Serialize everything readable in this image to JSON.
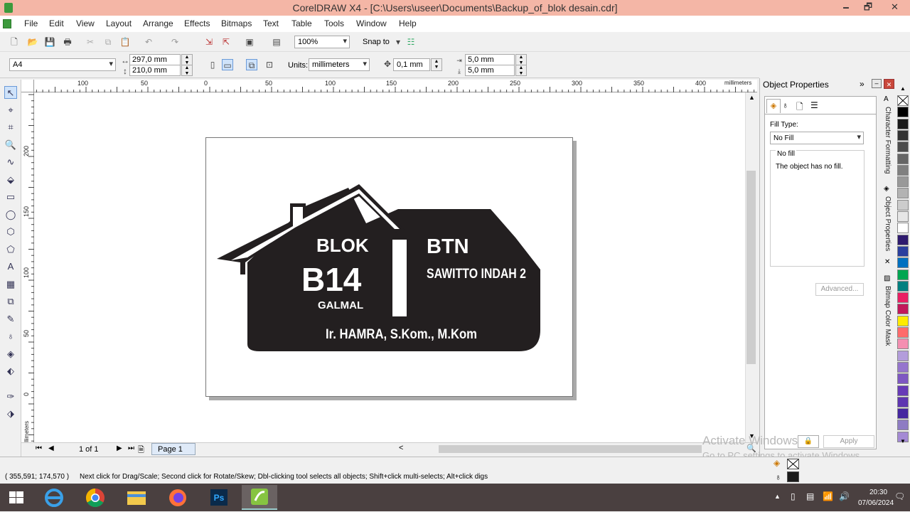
{
  "window": {
    "title": "CorelDRAW X4 - [C:\\Users\\useer\\Documents\\Backup_of_blok desain.cdr]",
    "minimize_glyph": "🗕",
    "restore_glyph": "🗗",
    "close_glyph": "✕"
  },
  "menu": [
    "File",
    "Edit",
    "View",
    "Layout",
    "Arrange",
    "Effects",
    "Bitmaps",
    "Text",
    "Table",
    "Tools",
    "Window",
    "Help"
  ],
  "toolbar": {
    "zoom": "100%",
    "snap_to": "Snap to"
  },
  "property_bar": {
    "paper_size": "A4",
    "width": "297,0 mm",
    "height": "210,0 mm",
    "units_label": "Units:",
    "units_value": "millimeters",
    "nudge": "0,1 mm",
    "dup_x": "5,0 mm",
    "dup_y": "5,0 mm"
  },
  "ruler": {
    "h_labels": [
      "100",
      "50",
      "0",
      "50",
      "100",
      "150",
      "200",
      "250",
      "300",
      "350",
      "400"
    ],
    "h_unit": "millimeters",
    "v_labels": [
      "200",
      "150",
      "100",
      "50",
      "0"
    ],
    "v_unit": "millimeters"
  },
  "design": {
    "blok": "BLOK",
    "code": "B14",
    "galmal": "GALMAL",
    "btn": "BTN",
    "housing": "SAWITTO INDAH 2",
    "owner": "Ir. HAMRA, S.Kom., M.Kom",
    "fill_color": "#231f20"
  },
  "page_nav": {
    "count": "1 of 1",
    "tab": "Page 1"
  },
  "docker": {
    "title": "Object Properties",
    "fill_type_label": "Fill Type:",
    "fill_type_value": "No Fill",
    "group_title": "No fill",
    "group_text": "The object has no fill.",
    "advanced": "Advanced...",
    "apply": "Apply",
    "tabs": [
      "Character Formatting",
      "Object Properties",
      "Bitmap Color Mask"
    ]
  },
  "palette_colors": [
    "#ffffff",
    "#000000",
    "#1a1a1a",
    "#333333",
    "#4d4d4d",
    "#666666",
    "#808080",
    "#999999",
    "#b3b3b3",
    "#cccccc",
    "#e6e6e6",
    "#ffffff",
    "#2e1a6e",
    "#2b3f9e",
    "#0070c0",
    "#00a651",
    "#008080",
    "#e91e63",
    "#c2185b",
    "#ffeb00",
    "#ff6b6b",
    "#f48fb1",
    "#b39ddb",
    "#9575cd",
    "#7e57c2",
    "#673ab7",
    "#5e35b1",
    "#4527a0",
    "#8e7cc3",
    "#a48ad4"
  ],
  "status": {
    "coords": "( 355,591; 174,570 )",
    "hint": "Next click for Drag/Scale; Second click for Rotate/Skew; Dbl-clicking tool selects all objects; Shift+click multi-selects; Alt+click digs"
  },
  "watermark": {
    "line1": "Activate Windows",
    "line2": "Go to PC settings to activate Windows."
  },
  "taskbar": {
    "time": "20:30",
    "date": "07/06/2024"
  }
}
